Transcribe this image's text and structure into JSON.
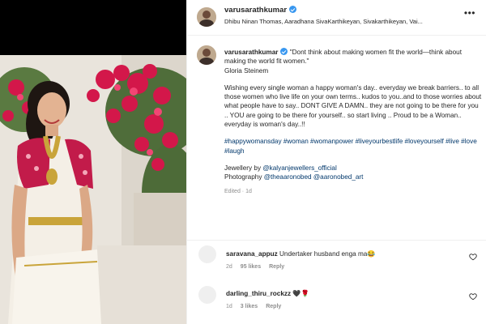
{
  "post": {
    "username": "varusarathkumar",
    "tagged": "Dhibu Ninan Thomas, Aaradhana SivaKarthikeyan, Sivakarthikeyan, Vai..."
  },
  "caption": {
    "username": "varusarathkumar",
    "quote": "\"Dont think about making women fit the world—think about making the world fit women.\"",
    "quote_author": "Gloria Steinem",
    "body": "Wishing every single woman a happy woman's day.. everyday we break barriers.. to all those women who live life on your own terms.. kudos to you..and to those worries about what people have to say.. DONT GIVE A DAMN.. they are not going to be there for you .. YOU are going to be there for yourself.. so start living .. Proud to be a Woman.. everyday is woman's day..!!",
    "hashtags": "#happywomansday #woman #womanpower #liveyourbestlife #loveyourself #live #love #laugh",
    "jewellery_prefix": "Jewellery by ",
    "jewellery_mention": "@kalyanjewellers_official",
    "photo_prefix": "Photography ",
    "photo_mention_1": "@theaaronobed",
    "photo_mention_2": "@aaronobed_art",
    "edited": "Edited · 1d"
  },
  "comments": [
    {
      "username": "saravana_appuz",
      "text": "Undertaker husband enga ma😂",
      "age": "2d",
      "likes": "95 likes",
      "reply": "Reply"
    },
    {
      "username": "darling_thiru_rockzz",
      "text": "🖤🌹",
      "age": "1d",
      "likes": "3 likes",
      "reply": "Reply"
    }
  ],
  "icons": {
    "more": "more-options-icon",
    "verified": "verified-badge-icon",
    "like": "heart-icon"
  },
  "colors": {
    "verified": "#3897f0",
    "link": "#00376b",
    "muted": "#8e8e8e",
    "saree_red": "#c21b4a",
    "saree_white": "#f4efe6",
    "bougainvillea": "#d3174a"
  }
}
